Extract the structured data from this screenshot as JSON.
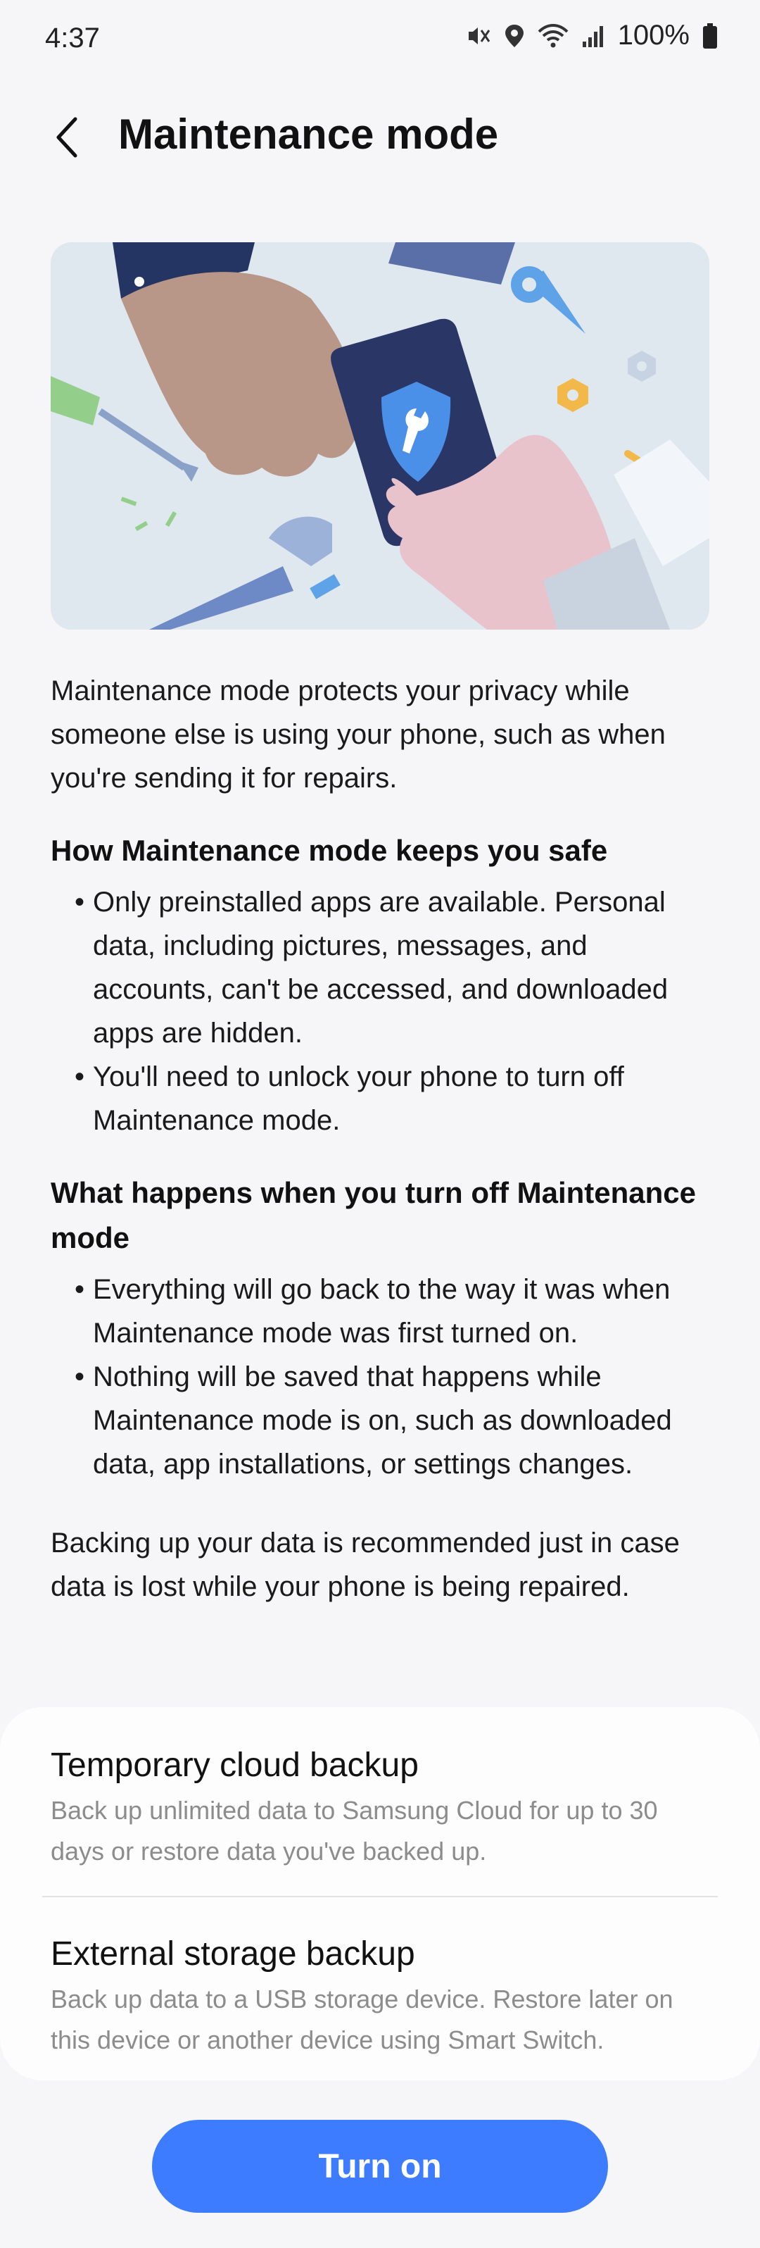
{
  "status_bar": {
    "time": "4:37",
    "battery": "100%",
    "icons": [
      "mute-vibrate-icon",
      "location-icon",
      "wifi-icon",
      "signal-icon",
      "battery-icon"
    ]
  },
  "header": {
    "title": "Maintenance mode",
    "back_icon": "back-arrow-icon"
  },
  "hero": {
    "icon": "shield-wrench-icon"
  },
  "intro": "Maintenance mode protects your privacy while someone else is using your phone, such as when you're sending it for repairs.",
  "section1": {
    "heading": "How Maintenance mode keeps you safe",
    "bullets": [
      "Only preinstalled apps are available. Personal data, including pictures, messages, and accounts, can't be accessed, and downloaded apps are hidden.",
      "You'll need to unlock your phone to turn off Maintenance mode."
    ]
  },
  "section2": {
    "heading": "What happens when you turn off Maintenance mode",
    "bullets": [
      "Everything will go back to the way it was when Maintenance mode was first turned on.",
      "Nothing will be saved that happens while Maintenance mode is on, such as downloaded data, app installations, or settings changes."
    ]
  },
  "outro": "Backing up your data is recommended just in case data is lost while your phone is being repaired.",
  "backup_options": [
    {
      "title": "Temporary cloud backup",
      "subtitle": "Back up unlimited data to Samsung Cloud for up to 30 days or restore data you've backed up."
    },
    {
      "title": "External storage backup",
      "subtitle": "Back up data to a USB storage device. Restore later on this device or another device using Smart Switch."
    }
  ],
  "cta": {
    "label": "Turn on"
  },
  "colors": {
    "accent": "#3d7bff",
    "background": "#f6f6f8",
    "card": "#fdfdfd",
    "subtext": "#8c8c8c"
  }
}
